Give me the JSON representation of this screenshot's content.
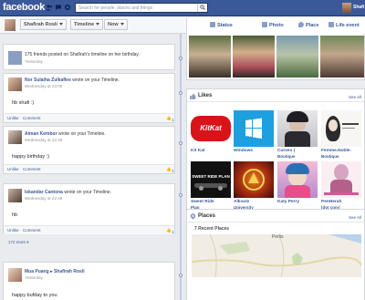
{
  "topbar": {
    "logo": "facebook",
    "search_placeholder": "Search for people, places and things",
    "user_name": "Shafi"
  },
  "subheader": {
    "profile_name": "Shafirah Rosli",
    "timeline_label": "Timeline",
    "now_label": "Now"
  },
  "composer": {
    "status": "Status",
    "photo": "Photo",
    "place": "Place",
    "life_event": "Life event"
  },
  "stories": [
    {
      "text": "175 friends posted on Shafirah's timeline on her birthday.",
      "time": "Yesterday"
    },
    {
      "author": "Nor Sulaiha Zulkaflee",
      "action": "wrote on your Timeline.",
      "time": "Wednesday at 23:09",
      "body": "hb shafi :)",
      "unlike": "Unlike",
      "comment": "Comment",
      "likes": "1"
    },
    {
      "author": "Aiman Kembor",
      "action": "wrote on your Timeline.",
      "time": "Wednesday at 22:49",
      "body": "happy birthday :)",
      "unlike": "Unlike",
      "comment": "Comment",
      "likes": "1"
    },
    {
      "author": "Iskandar Cantona",
      "action": "wrote on your Timeline.",
      "time": "Wednesday at 22:48",
      "body": "hb",
      "unlike": "Unlike",
      "comment": "Comment",
      "likes": "1"
    },
    {
      "author": "Mua Puang",
      "target": "Shafirah Rosli",
      "time": "Yesterday",
      "body": "happy bufday to you"
    }
  ],
  "more_link": "172 more",
  "likes_box": {
    "title": "Likes",
    "see_all": "See All",
    "items": [
      {
        "name": "Kit Kat",
        "sub": ""
      },
      {
        "name": "Windows",
        "sub": ""
      },
      {
        "name": "Curvex |",
        "sub": "Boutique"
      },
      {
        "name": "Femme.Noble.",
        "sub": "Boutique"
      },
      {
        "name": "Sweet Ride",
        "sub": "Plan"
      },
      {
        "name": "Alkoutz",
        "sub": "University"
      },
      {
        "name": "Katy Perry",
        "sub": ""
      },
      {
        "name": "PenHerah",
        "sub": "[dot com]"
      }
    ],
    "tile_texts": {
      "kitkat": "KitKat",
      "sweetride": "SWEET RIDE PLAN"
    }
  },
  "places_box": {
    "title": "Places",
    "see_all": "See All",
    "recent": "7 Recent Places",
    "map_label": "Perlis"
  },
  "colors": {
    "brand_blue": "#3b5998",
    "link": "#3b5998",
    "background": "#e9ebee"
  }
}
